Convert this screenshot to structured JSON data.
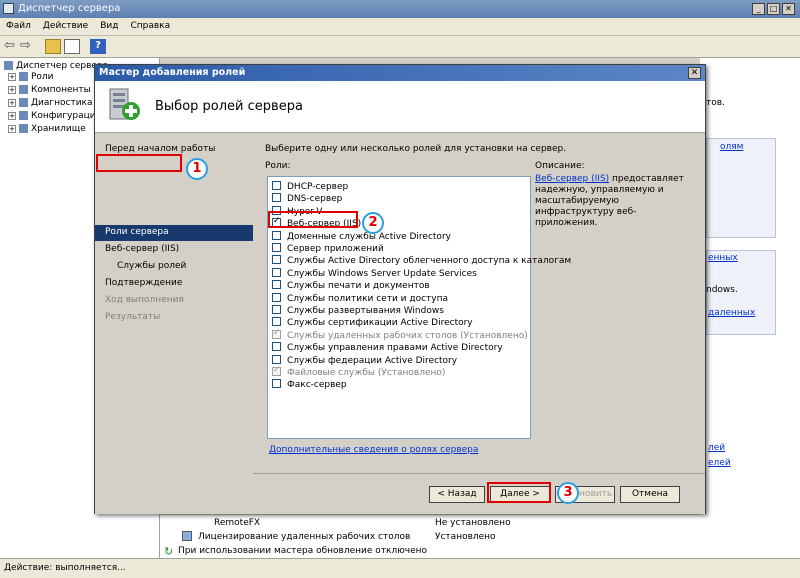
{
  "window": {
    "title": "Диспетчер сервера"
  },
  "menu": [
    "Файл",
    "Действие",
    "Вид",
    "Справка"
  ],
  "tree": {
    "root": "Диспетчер сервера",
    "items": [
      {
        "label": "Роли"
      },
      {
        "label": "Компоненты"
      },
      {
        "label": "Диагностика"
      },
      {
        "label": "Конфигурация"
      },
      {
        "label": "Хранилище"
      }
    ]
  },
  "right_fragments": {
    "t1": "тов.",
    "link1": "олям",
    "t2": "енных",
    "t3": "ndows.",
    "link2": "даленных",
    "link3": "лей",
    "link4": "елей"
  },
  "bottom_list": {
    "rows": [
      {
        "name": "RemoteFX",
        "status": "Не установлено"
      },
      {
        "name": "Лицензирование удаленных рабочих столов",
        "status": "Установлено"
      }
    ],
    "info": "При использовании мастера обновление отключено"
  },
  "status": "Действие: выполняется...",
  "dialog": {
    "title": "Мастер добавления ролей",
    "heading": "Выбор ролей сервера",
    "nav": [
      {
        "label": "Перед началом работы",
        "state": "normal"
      },
      {
        "label": "Роли сервера",
        "state": "selected"
      },
      {
        "label": "Веб-сервер (IIS)",
        "state": "normal"
      },
      {
        "label": "Службы ролей",
        "state": "sub"
      },
      {
        "label": "Подтверждение",
        "state": "normal"
      },
      {
        "label": "Ход выполнения",
        "state": "disabled"
      },
      {
        "label": "Результаты",
        "state": "disabled"
      }
    ],
    "instruction": "Выберите одну или несколько ролей для установки на сервер.",
    "roles_label": "Роли:",
    "roles": [
      {
        "label": "DHCP-сервер",
        "state": "unchecked"
      },
      {
        "label": "DNS-сервер",
        "state": "unchecked"
      },
      {
        "label": "Hyper-V",
        "state": "unchecked"
      },
      {
        "label": "Веб-сервер (IIS)",
        "state": "checked"
      },
      {
        "label": "Доменные службы Active Directory",
        "state": "unchecked"
      },
      {
        "label": "Сервер приложений",
        "state": "unchecked"
      },
      {
        "label": "Службы Active Directory облегченного доступа к каталогам",
        "state": "unchecked"
      },
      {
        "label": "Службы Windows Server Update Services",
        "state": "unchecked"
      },
      {
        "label": "Службы печати и документов",
        "state": "unchecked"
      },
      {
        "label": "Службы политики сети и доступа",
        "state": "unchecked"
      },
      {
        "label": "Службы развертывания Windows",
        "state": "unchecked"
      },
      {
        "label": "Службы сертификации Active Directory",
        "state": "unchecked"
      },
      {
        "label": "Службы удаленных рабочих столов (Установлено)",
        "state": "installed"
      },
      {
        "label": "Службы управления правами Active Directory",
        "state": "unchecked"
      },
      {
        "label": "Службы федерации Active Directory",
        "state": "unchecked"
      },
      {
        "label": "Файловые службы (Установлено)",
        "state": "installed"
      },
      {
        "label": "Факс-сервер",
        "state": "unchecked"
      }
    ],
    "description_label": "Описание:",
    "description_link": "Веб-сервер (IIS)",
    "description_text": "предоставляет надежную, управляемую и масштабируемую инфраструктуру веб-приложения.",
    "more_link": "Дополнительные сведения о ролях сервера",
    "buttons": {
      "back": "< Назад",
      "next": "Далее >",
      "install": "Установить",
      "cancel": "Отмена"
    }
  },
  "annotations": [
    "1",
    "2",
    "3"
  ]
}
